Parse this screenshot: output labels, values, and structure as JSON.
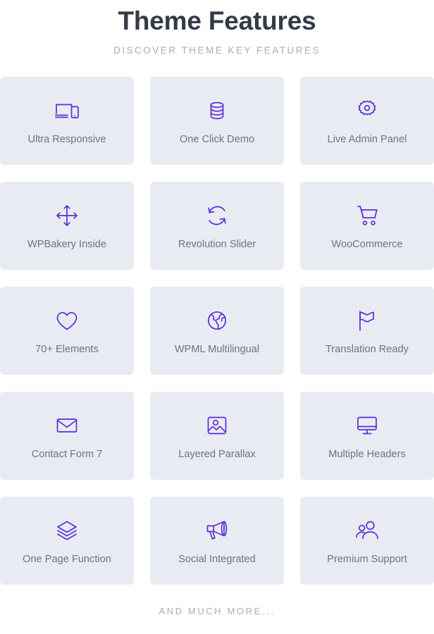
{
  "header": {
    "title": "Theme Features",
    "subtitle": "DISCOVER THEME KEY FEATURES"
  },
  "theme": {
    "accent": "#5b2ed6",
    "card_bg": "#e9ebf3",
    "title_color": "#343b47",
    "label_color": "#6e737f",
    "muted_color": "#a9adbb",
    "page_bg": "#ffffff"
  },
  "features": [
    {
      "label": "Ultra Responsive",
      "icon": "devices-responsive-icon"
    },
    {
      "label": "One Click Demo",
      "icon": "database-stack-icon"
    },
    {
      "label": "Live Admin Panel",
      "icon": "gear-icon"
    },
    {
      "label": "WPBakery Inside",
      "icon": "move-arrows-icon"
    },
    {
      "label": "Revolution Slider",
      "icon": "refresh-circle-icon"
    },
    {
      "label": "WooCommerce",
      "icon": "shopping-cart-icon"
    },
    {
      "label": "70+ Elements",
      "icon": "heart-icon"
    },
    {
      "label": "WPML Multilingual",
      "icon": "globe-icon"
    },
    {
      "label": "Translation Ready",
      "icon": "flag-icon"
    },
    {
      "label": "Contact Form 7",
      "icon": "envelope-icon"
    },
    {
      "label": "Layered Parallax",
      "icon": "image-photo-icon"
    },
    {
      "label": "Multiple Headers",
      "icon": "monitor-icon"
    },
    {
      "label": "One Page Function",
      "icon": "layers-icon"
    },
    {
      "label": "Social Integrated",
      "icon": "megaphone-icon"
    },
    {
      "label": "Premium Support",
      "icon": "users-group-icon"
    }
  ],
  "footer": {
    "text": "AND MUCH MORE..."
  }
}
